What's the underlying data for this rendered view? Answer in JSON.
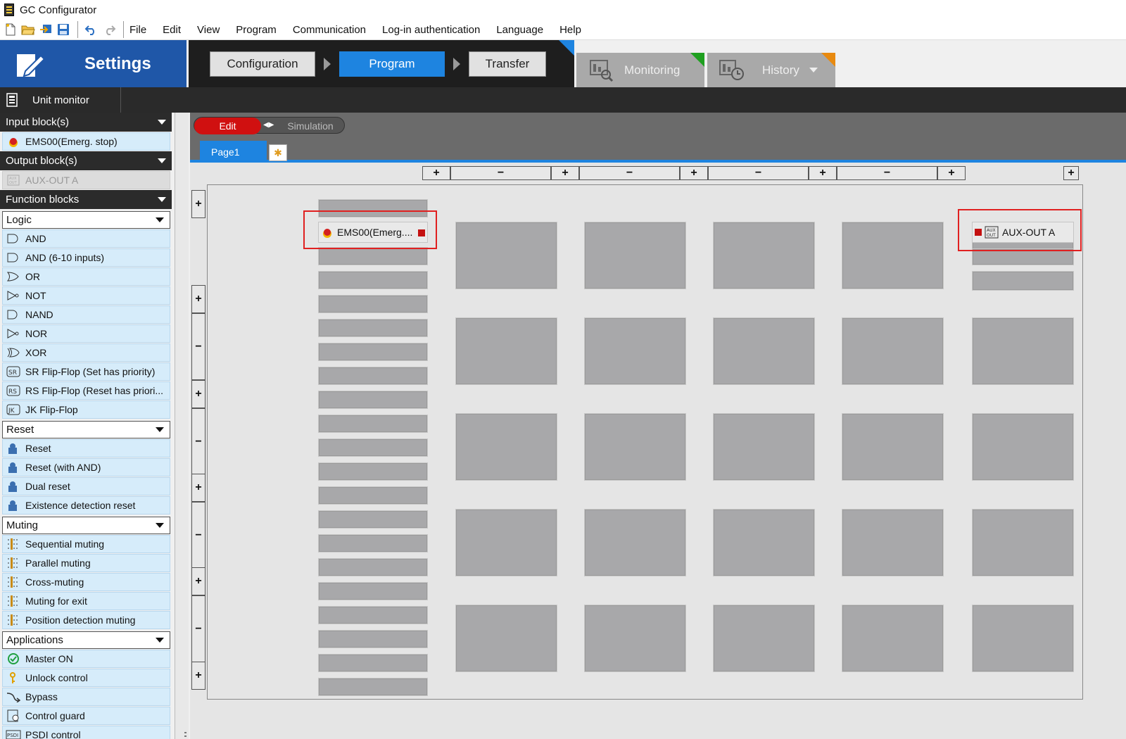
{
  "window": {
    "title": "GC Configurator"
  },
  "toolbar": {
    "icons": [
      "new-file-icon",
      "open-folder-icon",
      "import-icon",
      "save-icon",
      "undo-icon",
      "redo-icon"
    ]
  },
  "menu": [
    "File",
    "Edit",
    "View",
    "Program",
    "Communication",
    "Log-in authentication",
    "Language",
    "Help"
  ],
  "header": {
    "settings_label": "Settings",
    "steps": [
      {
        "label": "Configuration",
        "active": false
      },
      {
        "label": "Program",
        "active": true
      },
      {
        "label": "Transfer",
        "active": false
      }
    ],
    "monitoring_label": "Monitoring",
    "history_label": "History"
  },
  "unit_monitor": {
    "label": "Unit monitor"
  },
  "sidebar": {
    "input_blocks": {
      "title": "Input block(s)",
      "items": [
        "EMS00(Emerg. stop)"
      ]
    },
    "output_blocks": {
      "title": "Output block(s)",
      "items": [
        "AUX-OUT A"
      ]
    },
    "function_blocks": {
      "title": "Function blocks",
      "groups": [
        {
          "dropdown": "Logic",
          "items": [
            "AND",
            "AND (6-10 inputs)",
            "OR",
            "NOT",
            "NAND",
            "NOR",
            "XOR",
            "SR Flip-Flop (Set has priority)",
            "RS Flip-Flop (Reset has priori...",
            "JK Flip-Flop"
          ],
          "icons": [
            "and-gate-icon",
            "and-gate-icon",
            "or-gate-icon",
            "not-gate-icon",
            "nand-gate-icon",
            "nor-gate-icon",
            "xor-gate-icon",
            "sr-flipflop-icon",
            "rs-flipflop-icon",
            "jk-flipflop-icon"
          ]
        },
        {
          "dropdown": "Reset",
          "items": [
            "Reset",
            "Reset (with AND)",
            "Dual reset",
            "Existence detection reset"
          ],
          "icons": [
            "reset-icon",
            "reset-and-icon",
            "dual-reset-icon",
            "existence-reset-icon"
          ]
        },
        {
          "dropdown": "Muting",
          "items": [
            "Sequential muting",
            "Parallel muting",
            "Cross-muting",
            "Muting for exit",
            "Position detection muting"
          ],
          "icons": [
            "sequential-muting-icon",
            "parallel-muting-icon",
            "cross-muting-icon",
            "muting-exit-icon",
            "position-muting-icon"
          ]
        },
        {
          "dropdown": "Applications",
          "items": [
            "Master ON",
            "Unlock control",
            "Bypass",
            "Control guard",
            "PSDI control"
          ],
          "icons": [
            "master-on-icon",
            "unlock-icon",
            "bypass-icon",
            "control-guard-icon",
            "psdi-icon"
          ]
        }
      ]
    }
  },
  "editor": {
    "mode_edit": "Edit",
    "mode_simulation": "Simulation",
    "page_tab": "Page1",
    "page_add": "✱",
    "placed_input": "EMS00(Emerg....",
    "placed_output": "AUX-OUT A",
    "ruler_plus": "+",
    "ruler_minus": "−"
  },
  "colors": {
    "accent": "#1e84e0",
    "settings_blue": "#1f57a8",
    "edit_red": "#d01010",
    "item_bg": "#d6ecfa",
    "slot": "#a8a8aa",
    "selection": "#e02020"
  }
}
